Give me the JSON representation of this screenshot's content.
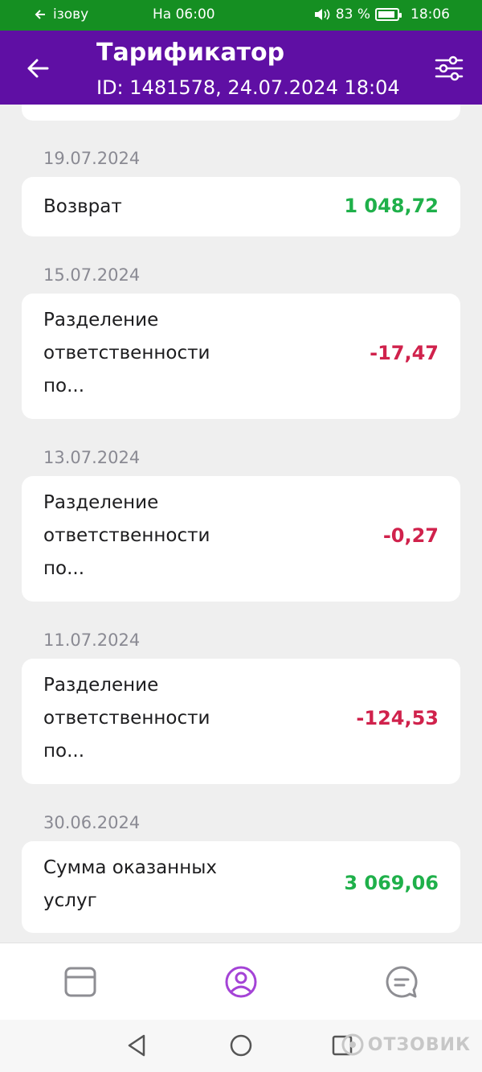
{
  "status_bar": {
    "back_app_label": "ізову",
    "center_text": "На 06:00",
    "battery_text": "83 %",
    "time": "18:06"
  },
  "appbar": {
    "title": "Тарификатор",
    "subtitle": "ID: 1481578, 24.07.2024 18:04",
    "back_icon": "arrow-left-icon",
    "filter_icon": "sliders-icon"
  },
  "entries": [
    {
      "date": "19.07.2024",
      "title_lines": [
        "Возврат"
      ],
      "amount": "1 048,72",
      "sign": "positive"
    },
    {
      "date": "15.07.2024",
      "title_lines": [
        "Разделение",
        "ответственности",
        "по..."
      ],
      "amount": "-17,47",
      "sign": "negative"
    },
    {
      "date": "13.07.2024",
      "title_lines": [
        "Разделение",
        "ответственности",
        "по..."
      ],
      "amount": "-0,27",
      "sign": "negative"
    },
    {
      "date": "11.07.2024",
      "title_lines": [
        "Разделение",
        "ответственности",
        "по..."
      ],
      "amount": "-124,53",
      "sign": "negative"
    },
    {
      "date": "30.06.2024",
      "title_lines": [
        "Сумма оказанных",
        "услуг"
      ],
      "amount": "3 069,06",
      "sign": "positive"
    }
  ],
  "bottom_nav": {
    "items": [
      "wallet-icon",
      "profile-icon",
      "chat-icon"
    ],
    "active_color": "#a443d6"
  },
  "watermark": "ОТЗОВИК",
  "colors": {
    "brand": "#5f0fa4",
    "status_bar": "#158f22",
    "positive": "#1fb04a",
    "negative": "#d0224c"
  }
}
